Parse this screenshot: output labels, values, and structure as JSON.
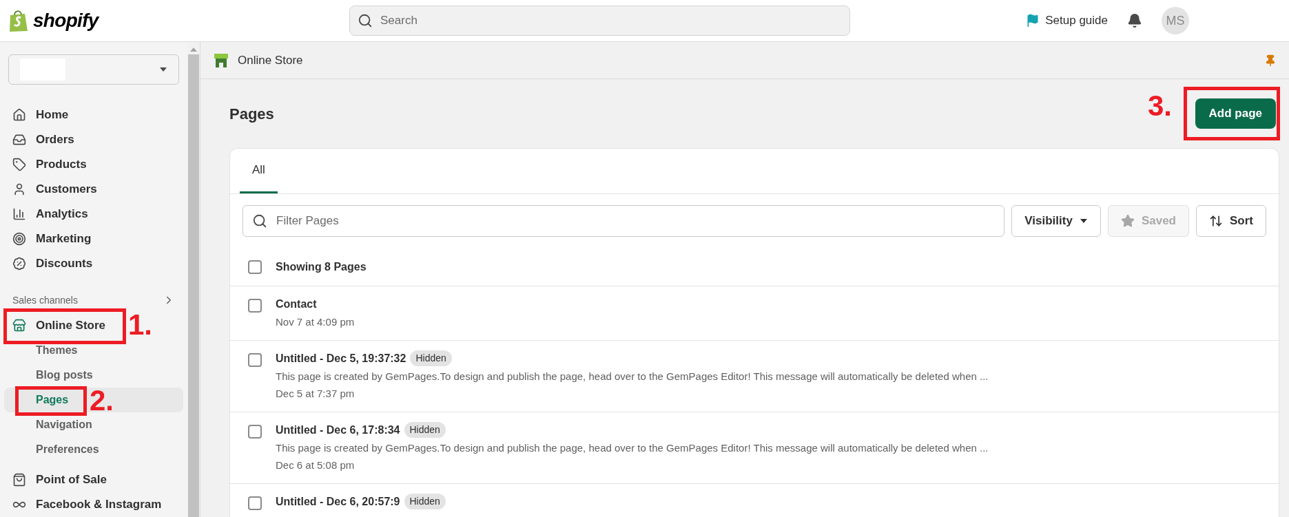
{
  "header": {
    "logo_text": "shopify",
    "search": {
      "placeholder": "Search"
    },
    "setup_guide": "Setup guide",
    "avatar": "MS"
  },
  "sidebar": {
    "items": [
      {
        "label": "Home",
        "kind": "main",
        "selected": false
      },
      {
        "label": "Orders",
        "kind": "main",
        "selected": false
      },
      {
        "label": "Products",
        "kind": "main",
        "selected": false
      },
      {
        "label": "Customers",
        "kind": "main",
        "selected": false
      },
      {
        "label": "Analytics",
        "kind": "main",
        "selected": false
      },
      {
        "label": "Marketing",
        "kind": "main",
        "selected": false
      },
      {
        "label": "Discounts",
        "kind": "main",
        "selected": false
      }
    ],
    "section_title": "Sales channels",
    "channels": [
      {
        "label": "Online Store",
        "kind": "channel",
        "selected": false,
        "children": [
          {
            "label": "Themes",
            "selected": false
          },
          {
            "label": "Blog posts",
            "selected": false
          },
          {
            "label": "Pages",
            "selected": true
          },
          {
            "label": "Navigation",
            "selected": false
          },
          {
            "label": "Preferences",
            "selected": false
          }
        ]
      },
      {
        "label": "Point of Sale",
        "kind": "main",
        "selected": false
      },
      {
        "label": "Facebook & Instagram",
        "kind": "main",
        "selected": false
      }
    ]
  },
  "breadcrumb": "Online Store",
  "page_title": "Pages",
  "primary_button": "Add page",
  "tabs": [
    {
      "label": "All",
      "selected": true
    }
  ],
  "filter": {
    "placeholder": "Filter Pages",
    "buttons": [
      {
        "label": "Visibility",
        "kind": "dropdown",
        "disabled": false
      },
      {
        "label": "Saved",
        "kind": "star",
        "disabled": true
      },
      {
        "label": "Sort",
        "kind": "sort",
        "disabled": false
      }
    ]
  },
  "list_header": {
    "label": "Showing 8 Pages",
    "checked": false
  },
  "rows": [
    {
      "title": "Contact",
      "checked": false,
      "date": "Nov 7 at 4:09 pm"
    },
    {
      "title": "Untitled - Dec 5, 19:37:32",
      "badge": "Hidden",
      "checked": false,
      "description": "This page is created by GemPages.To design and publish the page, head over to the GemPages Editor! This message will automatically be deleted when ...",
      "date": "Dec 5 at 7:37 pm"
    },
    {
      "title": "Untitled - Dec 6, 17:8:34",
      "badge": "Hidden",
      "checked": false,
      "description": "This page is created by GemPages.To design and publish the page, head over to the GemPages Editor! This message will automatically be deleted when ...",
      "date": "Dec 6 at 5:08 pm"
    },
    {
      "title": "Untitled - Dec 6, 20:57:9",
      "badge": "Hidden",
      "checked": false
    }
  ],
  "annotations": [
    {
      "label": "1."
    },
    {
      "label": "2."
    },
    {
      "label": "3."
    }
  ]
}
